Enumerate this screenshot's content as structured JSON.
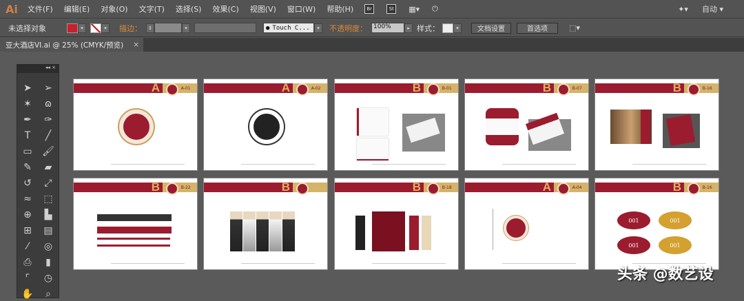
{
  "app": {
    "logo": "Ai"
  },
  "menu": [
    "文件(F)",
    "编辑(E)",
    "对象(O)",
    "文字(T)",
    "选择(S)",
    "效果(C)",
    "视图(V)",
    "窗口(W)",
    "帮助(H)"
  ],
  "menu_icons": {
    "bridge": "Br",
    "stock": "St"
  },
  "workspace": "自动",
  "control": {
    "selection": "未选择对象",
    "stroke_label": "描边：",
    "brush": "Touch C...",
    "opacity_label": "不透明度：",
    "opacity": "100%",
    "style_label": "样式：",
    "doc_setup": "文档设置",
    "prefs": "首选项",
    "fill_color": "#c8202e"
  },
  "tab": {
    "title": "亚大酒店VI.ai @ 25% (CMYK/预览)",
    "close": "×"
  },
  "toolbox": {
    "collapse": "◂◂",
    "close": "×",
    "tools": [
      "selection",
      "direct-selection",
      "magic-wand",
      "lasso",
      "pen",
      "curvature",
      "type",
      "line",
      "rectangle",
      "paintbrush",
      "pencil",
      "eraser",
      "rotate",
      "scale",
      "warp",
      "free-transform",
      "shape-builder",
      "graph",
      "mesh",
      "gradient",
      "eyedropper",
      "blend",
      "symbol-sprayer",
      "column-graph",
      "artboard",
      "slice",
      "hand",
      "zoom"
    ]
  },
  "artboards": [
    {
      "letter": "A",
      "code": "A-01",
      "kind": "logo"
    },
    {
      "letter": "A",
      "code": "A-02",
      "kind": "logo-bw"
    },
    {
      "letter": "B",
      "code": "B-01",
      "kind": "cards"
    },
    {
      "letter": "B",
      "code": "B-07",
      "kind": "envelope"
    },
    {
      "letter": "B",
      "code": "B-16",
      "kind": "menu"
    },
    {
      "letter": "B",
      "code": "B-22",
      "kind": "bars"
    },
    {
      "letter": "B",
      "code": "",
      "kind": "uniform"
    },
    {
      "letter": "B",
      "code": "B-18",
      "kind": "banners"
    },
    {
      "letter": "A",
      "code": "A-04",
      "kind": "logo-grid"
    },
    {
      "letter": "B",
      "code": "B-16",
      "kind": "tags"
    }
  ],
  "tag_number": "001",
  "watermark": "头条 @数艺设",
  "colors": {
    "brand_red": "#9b1c2e",
    "brand_gold": "#d4b46a"
  }
}
